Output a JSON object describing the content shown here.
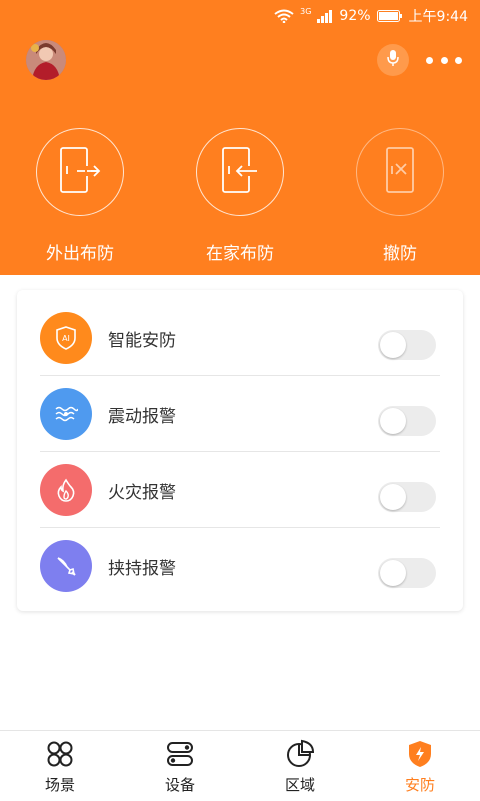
{
  "status_bar": {
    "network": "3G",
    "battery": "92%",
    "time": "上午9:44"
  },
  "header": {
    "avatar": "user-avatar",
    "mic": "microphone-icon",
    "more": "more-icon"
  },
  "arm_modes": [
    {
      "label": "外出布防",
      "icon": "door-exit-icon"
    },
    {
      "label": "在家布防",
      "icon": "door-enter-icon"
    },
    {
      "label": "撤防",
      "icon": "door-disarm-icon"
    }
  ],
  "security_items": [
    {
      "label": "智能安防",
      "icon": "ai-shield-icon",
      "color": "#ff8a1c",
      "enabled": false
    },
    {
      "label": "震动报警",
      "icon": "vibration-icon",
      "color": "#4f9aef",
      "enabled": false
    },
    {
      "label": "火灾报警",
      "icon": "fire-icon",
      "color": "#f46c6c",
      "enabled": false
    },
    {
      "label": "挟持报警",
      "icon": "knife-icon",
      "color": "#7e7fef",
      "enabled": false
    }
  ],
  "tabs": [
    {
      "label": "场景",
      "icon": "scene-icon",
      "active": false
    },
    {
      "label": "设备",
      "icon": "device-icon",
      "active": false
    },
    {
      "label": "区域",
      "icon": "region-icon",
      "active": false
    },
    {
      "label": "安防",
      "icon": "security-icon",
      "active": true
    }
  ],
  "colors": {
    "accent": "#ff7f1f",
    "toggle_off": "#ececec"
  }
}
